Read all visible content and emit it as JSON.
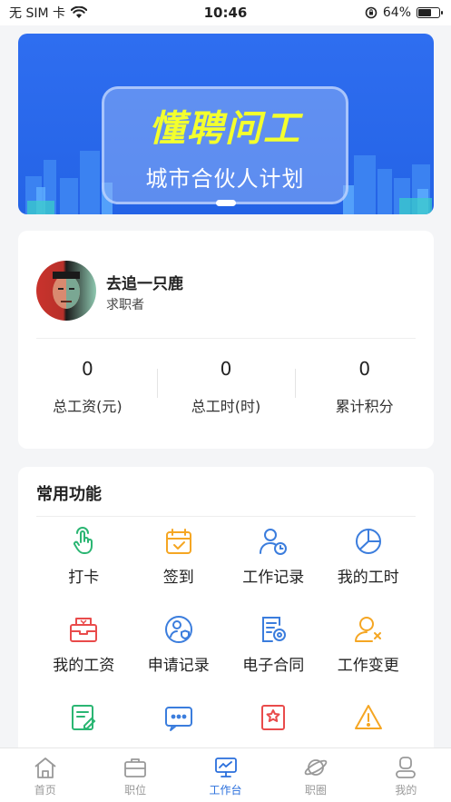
{
  "status_bar": {
    "carrier": "无 SIM 卡",
    "time": "10:46",
    "battery_pct": "64%",
    "battery_level": 0.64
  },
  "banner": {
    "title": "懂聘问工",
    "subtitle": "城市合伙人计划"
  },
  "profile": {
    "name": "去追一只鹿",
    "role": "求职者",
    "stats": [
      {
        "value": "0",
        "label": "总工资(元)"
      },
      {
        "value": "0",
        "label": "总工时(时)"
      },
      {
        "value": "0",
        "label": "累计积分"
      }
    ]
  },
  "functions": {
    "title": "常用功能",
    "items": [
      {
        "label": "打卡",
        "icon": "tap-icon",
        "color": "#2bb673"
      },
      {
        "label": "签到",
        "icon": "calendar-check-icon",
        "color": "#f5a623"
      },
      {
        "label": "工作记录",
        "icon": "user-clock-icon",
        "color": "#3b7ddd"
      },
      {
        "label": "我的工时",
        "icon": "pie-chart-icon",
        "color": "#3b7ddd"
      },
      {
        "label": "我的工资",
        "icon": "wallet-icon",
        "color": "#e94b4b"
      },
      {
        "label": "申请记录",
        "icon": "user-shield-icon",
        "color": "#3b7ddd"
      },
      {
        "label": "电子合同",
        "icon": "contract-icon",
        "color": "#3b7ddd"
      },
      {
        "label": "工作变更",
        "icon": "user-x-icon",
        "color": "#f5a623"
      },
      {
        "label": "",
        "icon": "edit-doc-icon",
        "color": "#2bb673"
      },
      {
        "label": "",
        "icon": "message-icon",
        "color": "#3b7ddd"
      },
      {
        "label": "",
        "icon": "star-doc-icon",
        "color": "#e94b4b"
      },
      {
        "label": "",
        "icon": "warning-icon",
        "color": "#f5a623"
      }
    ]
  },
  "tabbar": {
    "items": [
      {
        "label": "首页",
        "icon": "home-icon"
      },
      {
        "label": "职位",
        "icon": "briefcase-icon"
      },
      {
        "label": "工作台",
        "icon": "monitor-chart-icon",
        "active": true
      },
      {
        "label": "职圈",
        "icon": "planet-icon"
      },
      {
        "label": "我的",
        "icon": "person-icon"
      }
    ],
    "active_color": "#2a6fdc",
    "inactive_color": "#999999"
  }
}
